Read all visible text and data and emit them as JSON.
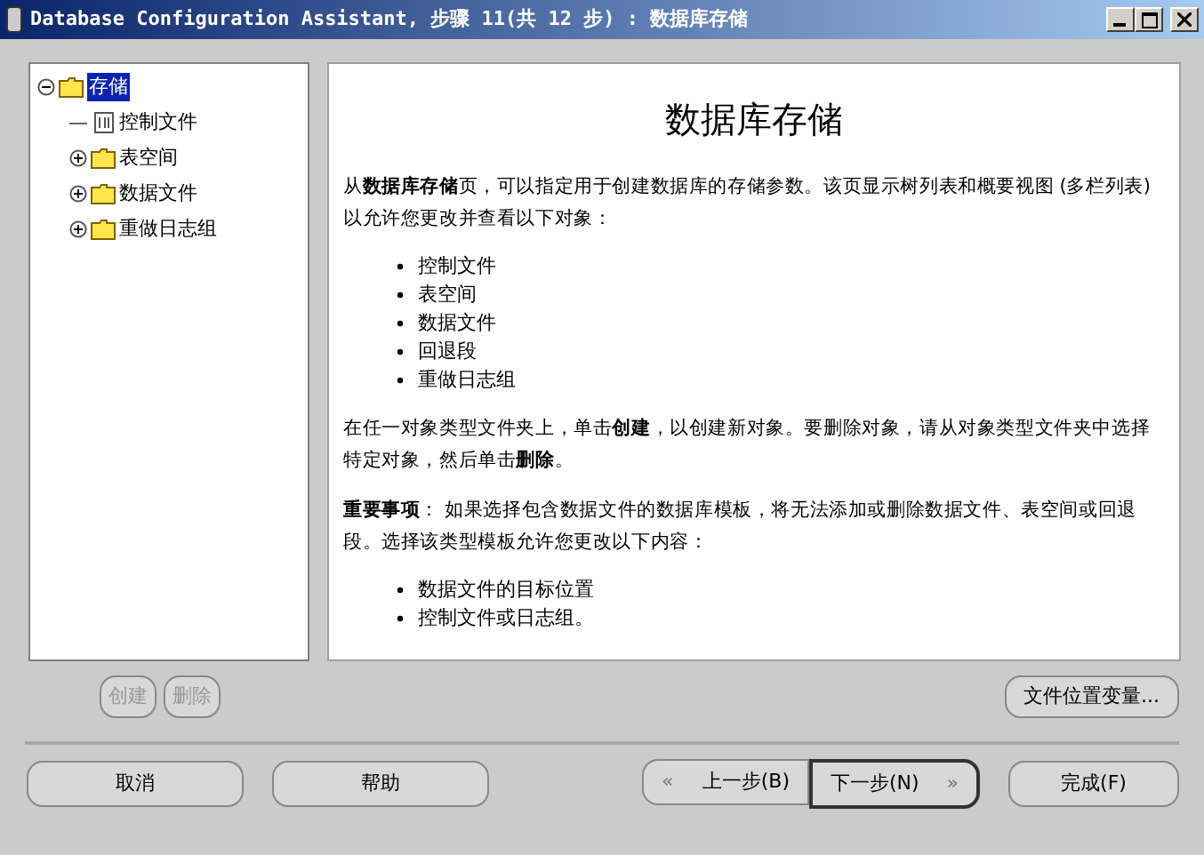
{
  "window": {
    "title": "Database Configuration Assistant, 步骤 11(共 12 步) : 数据库存储"
  },
  "tree": [
    {
      "label": "存储",
      "kind": "folder",
      "expanded": true,
      "selected": true,
      "children": [
        {
          "label": "控制文件",
          "kind": "file",
          "selected": false
        },
        {
          "label": "表空间",
          "kind": "folder",
          "expanded": false,
          "selected": false
        },
        {
          "label": "数据文件",
          "kind": "folder",
          "expanded": false,
          "selected": false
        },
        {
          "label": "重做日志组",
          "kind": "folder",
          "expanded": false,
          "selected": false
        }
      ]
    }
  ],
  "help": {
    "heading": "数据库存储",
    "blocks": [
      {
        "kind": "para",
        "text": "从**数据库存储**页，可以指定用于创建数据库的存储参数。该页显示树列表和概要视图 (多栏列表) 以允许您更改并查看以下对象："
      },
      {
        "kind": "list",
        "items": [
          "控制文件",
          "表空间",
          "数据文件",
          "回退段",
          "重做日志组"
        ]
      },
      {
        "kind": "para",
        "text": "在任一对象类型文件夹上，单击**创建**，以创建新对象。要删除对象，请从对象类型文件夹中选择特定对象，然后单击**删除**。"
      },
      {
        "kind": "para",
        "text": "**重要事项**： 如果选择包含数据文件的数据库模板，将无法添加或删除数据文件、表空间或回退段。选择该类型模板允许您更改以下内容："
      },
      {
        "kind": "list",
        "items": [
          "数据文件的目标位置",
          "控制文件或日志组。"
        ]
      }
    ]
  },
  "tree_buttons": [
    {
      "label": "创建",
      "disabled": true
    },
    {
      "label": "删除",
      "disabled": true
    }
  ],
  "file_location_button": "文件位置变量...",
  "footer": {
    "left": [
      "取消",
      "帮助"
    ],
    "back": {
      "arrow": "«",
      "label": "上一步(B)"
    },
    "next": {
      "label": "下一步(N)",
      "arrow": "»"
    },
    "finish": "完成(F)"
  }
}
